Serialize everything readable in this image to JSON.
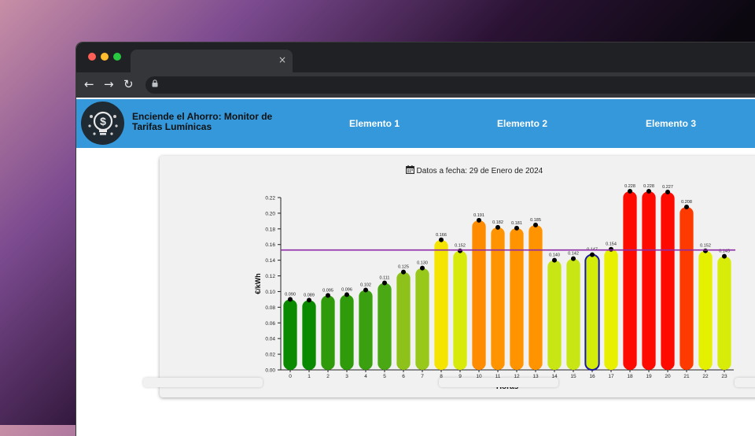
{
  "browser": {
    "tab_close": "×",
    "nav": {
      "back": "←",
      "forward": "→",
      "reload": "↻"
    },
    "lock_icon": "lock-icon"
  },
  "site": {
    "brand": "Enciende el Ahorro: Monitor de Tarifas Lumínicas",
    "nav_items": [
      "Elemento 1",
      "Elemento 2",
      "Elemento 3"
    ],
    "header_color": "#3498db"
  },
  "date_header": "Datos a fecha: 29 de Enero de 2024",
  "chart_data": {
    "type": "bar",
    "xlabel": "Horas",
    "ylabel": "€/kWh",
    "ylim": [
      0,
      0.22
    ],
    "yticks": [
      "0.00",
      "0.02",
      "0.04",
      "0.06",
      "0.08",
      "0.10",
      "0.12",
      "0.14",
      "0.16",
      "0.18",
      "0.20",
      "0.22"
    ],
    "categories": [
      "0",
      "1",
      "2",
      "3",
      "4",
      "5",
      "6",
      "7",
      "8",
      "9",
      "10",
      "11",
      "12",
      "13",
      "14",
      "15",
      "16",
      "17",
      "18",
      "19",
      "20",
      "21",
      "22",
      "23"
    ],
    "values": [
      0.09,
      0.089,
      0.095,
      0.096,
      0.102,
      0.111,
      0.125,
      0.13,
      0.166,
      0.152,
      0.191,
      0.182,
      0.181,
      0.185,
      0.14,
      0.142,
      0.147,
      0.154,
      0.228,
      0.228,
      0.227,
      0.208,
      0.152,
      0.145
    ],
    "labels": [
      "0.090",
      "0.089",
      "0.095",
      "0.096",
      "0.102",
      "0.111",
      "0.125",
      "0.130",
      "0.166",
      "0.152",
      "0.191",
      "0.182",
      "0.181",
      "0.185",
      "0.140",
      "0.142",
      "0.147",
      "0.154",
      "0.228",
      "0.228",
      "0.227",
      "0.208",
      "0.152",
      "0.145"
    ],
    "colors": [
      "#0a8a00",
      "#0a8a00",
      "#2f9a0a",
      "#2f9a0a",
      "#3aa00f",
      "#4aa814",
      "#8ec21a",
      "#98c81a",
      "#f4e400",
      "#d8ea0a",
      "#ff8c00",
      "#ff9400",
      "#ff9400",
      "#ff9400",
      "#c8e614",
      "#c8e614",
      "#d4ec0a",
      "#e8f000",
      "#ff0a00",
      "#ff0a00",
      "#ff0a00",
      "#ff3a00",
      "#e4f000",
      "#d8ec0a"
    ],
    "highlight_index": 16,
    "average_line": 0.153,
    "average_color": "#8e2aa8",
    "grid": false
  }
}
